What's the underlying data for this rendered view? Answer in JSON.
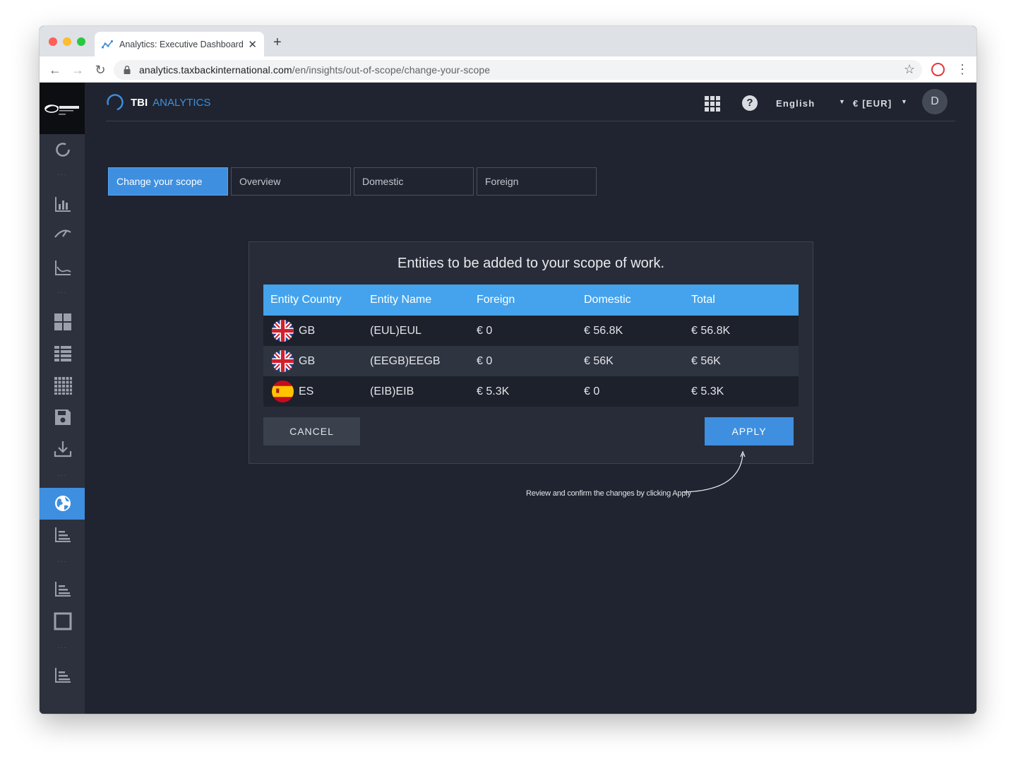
{
  "browser": {
    "tab_title": "Analytics: Executive Dashboard",
    "url_host": "analytics.taxbackinternational.com",
    "url_path": "/en/insights/out-of-scope/change-your-scope"
  },
  "header": {
    "brand_tbi": "TBI",
    "brand_analytics": "ANALYTICS",
    "language": "English",
    "currency": "€ [EUR]",
    "avatar_initial": "D"
  },
  "tabs": [
    {
      "label": "Change your scope",
      "active": true
    },
    {
      "label": "Overview",
      "active": false
    },
    {
      "label": "Domestic",
      "active": false
    },
    {
      "label": "Foreign",
      "active": false
    }
  ],
  "modal": {
    "title": "Entities to be added to your scope of work.",
    "columns": [
      "Entity Country",
      "Entity Name",
      "Foreign",
      "Domestic",
      "Total"
    ],
    "rows": [
      {
        "country": "GB",
        "name": "(EUL)EUL",
        "foreign": "€ 0",
        "domestic": "€ 56.8K",
        "total": "€ 56.8K"
      },
      {
        "country": "GB",
        "name": "(EEGB)EEGB",
        "foreign": "€ 0",
        "domestic": "€ 56K",
        "total": "€ 56K"
      },
      {
        "country": "ES",
        "name": "(EIB)EIB",
        "foreign": "€ 5.3K",
        "domestic": "€ 0",
        "total": "€ 5.3K"
      }
    ],
    "cancel_label": "CANCEL",
    "apply_label": "APPLY"
  },
  "annotation": "Review and confirm the changes by clicking Apply",
  "colors": {
    "accent": "#3e8fe0",
    "table_header": "#44a3ec",
    "background": "#1f2430",
    "sidebar": "#2c313d"
  }
}
